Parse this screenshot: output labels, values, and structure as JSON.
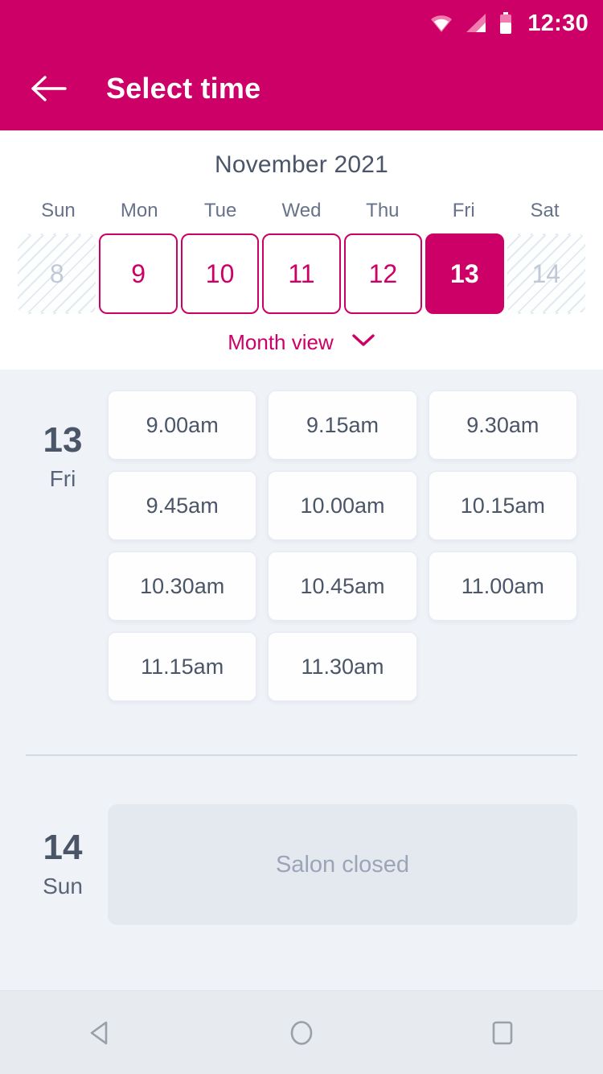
{
  "statusbar": {
    "time": "12:30",
    "icons": [
      "wifi-icon",
      "signal-icon",
      "battery-icon"
    ]
  },
  "appbar": {
    "title": "Select time",
    "back_icon": "back-arrow-icon"
  },
  "calendar": {
    "month_label": "November 2021",
    "weekday_headers": [
      "Sun",
      "Mon",
      "Tue",
      "Wed",
      "Thu",
      "Fri",
      "Sat"
    ],
    "days": [
      {
        "num": "8",
        "state": "disabled"
      },
      {
        "num": "9",
        "state": "available"
      },
      {
        "num": "10",
        "state": "available"
      },
      {
        "num": "11",
        "state": "available"
      },
      {
        "num": "12",
        "state": "available"
      },
      {
        "num": "13",
        "state": "selected"
      },
      {
        "num": "14",
        "state": "disabled"
      }
    ],
    "month_view_label": "Month view",
    "month_view_icon": "chevron-down-icon"
  },
  "schedule": [
    {
      "day_number": "13",
      "day_name": "Fri",
      "slots": [
        "9.00am",
        "9.15am",
        "9.30am",
        "9.45am",
        "10.00am",
        "10.15am",
        "10.30am",
        "10.45am",
        "11.00am",
        "11.15am",
        "11.30am"
      ]
    },
    {
      "day_number": "14",
      "day_name": "Sun",
      "closed_label": "Salon closed"
    }
  ],
  "navbar": {
    "back_label": "back-icon",
    "home_label": "home-icon",
    "recents_label": "recents-icon"
  },
  "colors": {
    "brand": "#CC0066",
    "background": "#EFF2F7",
    "text_dark": "#4A5568",
    "text_muted": "#9BA5B7"
  }
}
